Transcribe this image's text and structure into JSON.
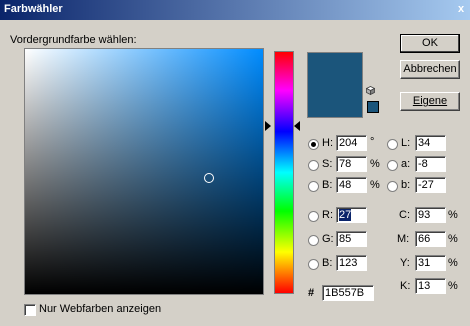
{
  "window": {
    "title": "Farbwähler",
    "close_label": "x"
  },
  "prompt": "Vordergrundfarbe wählen:",
  "buttons": {
    "ok": "OK",
    "cancel": "Abbrechen",
    "custom": "Eigene"
  },
  "current_color": "#1b557b",
  "hsb": {
    "h": {
      "label": "H:",
      "value": "204",
      "unit": "°",
      "selected": true
    },
    "s": {
      "label": "S:",
      "value": "78",
      "unit": "%"
    },
    "b": {
      "label": "B:",
      "value": "48",
      "unit": "%"
    }
  },
  "lab": {
    "l": {
      "label": "L:",
      "value": "34"
    },
    "a": {
      "label": "a:",
      "value": "-8"
    },
    "b": {
      "label": "b:",
      "value": "-27"
    }
  },
  "rgb": {
    "r": {
      "label": "R:",
      "value": "27"
    },
    "g": {
      "label": "G:",
      "value": "85"
    },
    "b": {
      "label": "B:",
      "value": "123"
    }
  },
  "cmyk": {
    "c": {
      "label": "C:",
      "value": "93",
      "unit": "%"
    },
    "m": {
      "label": "M:",
      "value": "66",
      "unit": "%"
    },
    "y": {
      "label": "Y:",
      "value": "31",
      "unit": "%"
    },
    "k": {
      "label": "K:",
      "value": "13",
      "unit": "%"
    }
  },
  "hex": {
    "label": "#",
    "value": "1B557B"
  },
  "web_colors_only": {
    "label": "Nur Webfarben anzeigen",
    "checked": false
  }
}
